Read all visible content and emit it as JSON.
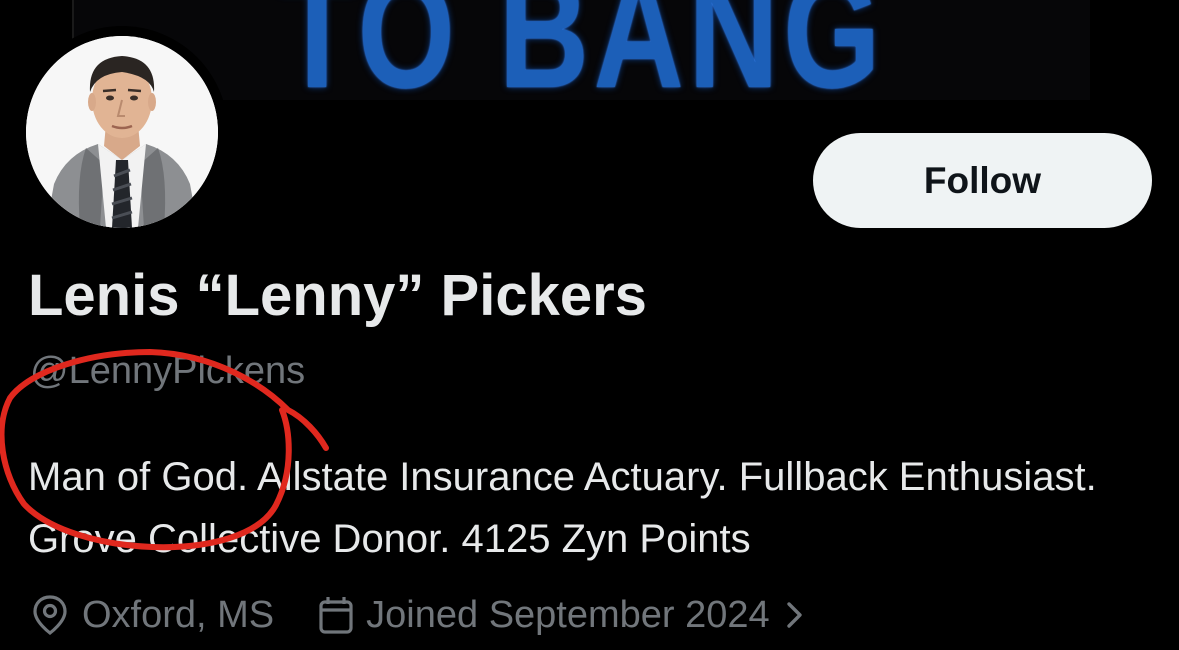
{
  "banner": {
    "text": "TO BANG"
  },
  "profile": {
    "display_name": "Lenis “Lenny” Pickers",
    "handle": "@LennyPickens",
    "bio": "Man of God. Allstate Insurance Actuary. Fullback Enthusiast. Grove Collective Donor. 4125 Zyn Points",
    "location": "Oxford, MS",
    "joined": "Joined September 2024"
  },
  "actions": {
    "follow_label": "Follow"
  },
  "icons": {
    "location": "location-pin-icon",
    "calendar": "calendar-icon",
    "chevron": "chevron-right-icon"
  },
  "colors": {
    "background": "#000000",
    "primary_text": "#e7e9ea",
    "secondary_text": "#71767b",
    "follow_button_bg": "#eff3f4",
    "annotation": "#e0281e",
    "banner_text": "#1c5fb8"
  }
}
